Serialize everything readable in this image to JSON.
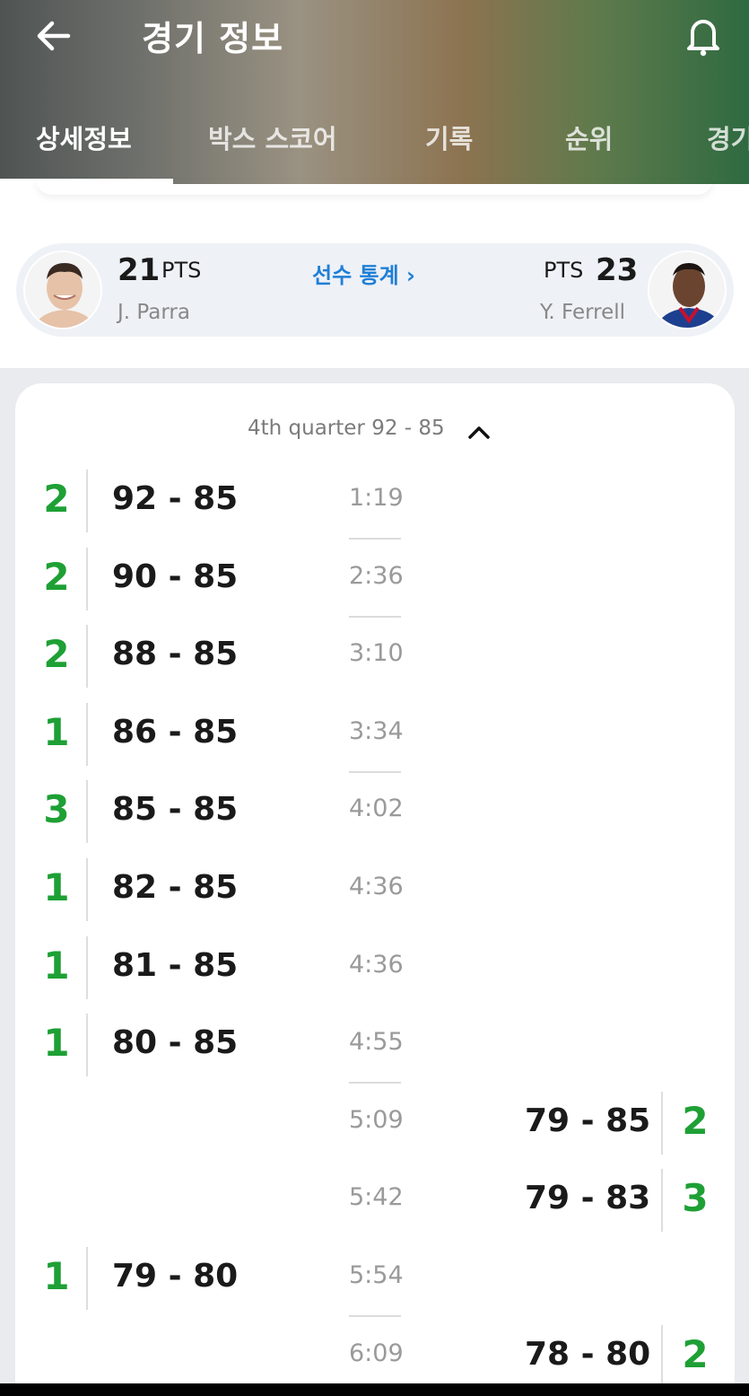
{
  "header": {
    "title": "경기 정보",
    "tabs": [
      {
        "label": "상세정보",
        "active": true
      },
      {
        "label": "박스 스코어",
        "active": false
      },
      {
        "label": "기록",
        "active": false
      },
      {
        "label": "순위",
        "active": false
      },
      {
        "label": "경기",
        "active": false
      }
    ]
  },
  "leaders": {
    "left": {
      "pts": "21",
      "pts_label": "PTS",
      "name": "J. Parra"
    },
    "right": {
      "pts": "23",
      "pts_label": "PTS",
      "name": "Y. Ferrell"
    },
    "stats_link": "선수 통계 ›"
  },
  "quarter": {
    "label": "4th quarter 92 - 85"
  },
  "plays": [
    {
      "side": "home",
      "points": "2",
      "score": "92 - 85",
      "time": "1:19",
      "divider": true
    },
    {
      "side": "home",
      "points": "2",
      "score": "90 - 85",
      "time": "2:36",
      "divider": true
    },
    {
      "side": "home",
      "points": "2",
      "score": "88 - 85",
      "time": "3:10",
      "divider": false
    },
    {
      "side": "home",
      "points": "1",
      "score": "86 - 85",
      "time": "3:34",
      "divider": true
    },
    {
      "side": "home",
      "points": "3",
      "score": "85 - 85",
      "time": "4:02",
      "divider": false
    },
    {
      "side": "home",
      "points": "1",
      "score": "82 - 85",
      "time": "4:36",
      "divider": false
    },
    {
      "side": "home",
      "points": "1",
      "score": "81 - 85",
      "time": "4:36",
      "divider": false
    },
    {
      "side": "home",
      "points": "1",
      "score": "80 - 85",
      "time": "4:55",
      "divider": true
    },
    {
      "side": "away",
      "points": "2",
      "score": "79 - 85",
      "time": "5:09",
      "divider": false
    },
    {
      "side": "away",
      "points": "3",
      "score": "79 - 83",
      "time": "5:42",
      "divider": false
    },
    {
      "side": "home",
      "points": "1",
      "score": "79 - 80",
      "time": "5:54",
      "divider": true
    },
    {
      "side": "away",
      "points": "2",
      "score": "78 - 80",
      "time": "6:09",
      "divider": false
    }
  ],
  "colors": {
    "points": "#1ea035",
    "link": "#1f7fd6"
  },
  "icons": {
    "back": "arrow-left-icon",
    "notify": "bell-icon",
    "collapse": "chevron-up-icon"
  }
}
